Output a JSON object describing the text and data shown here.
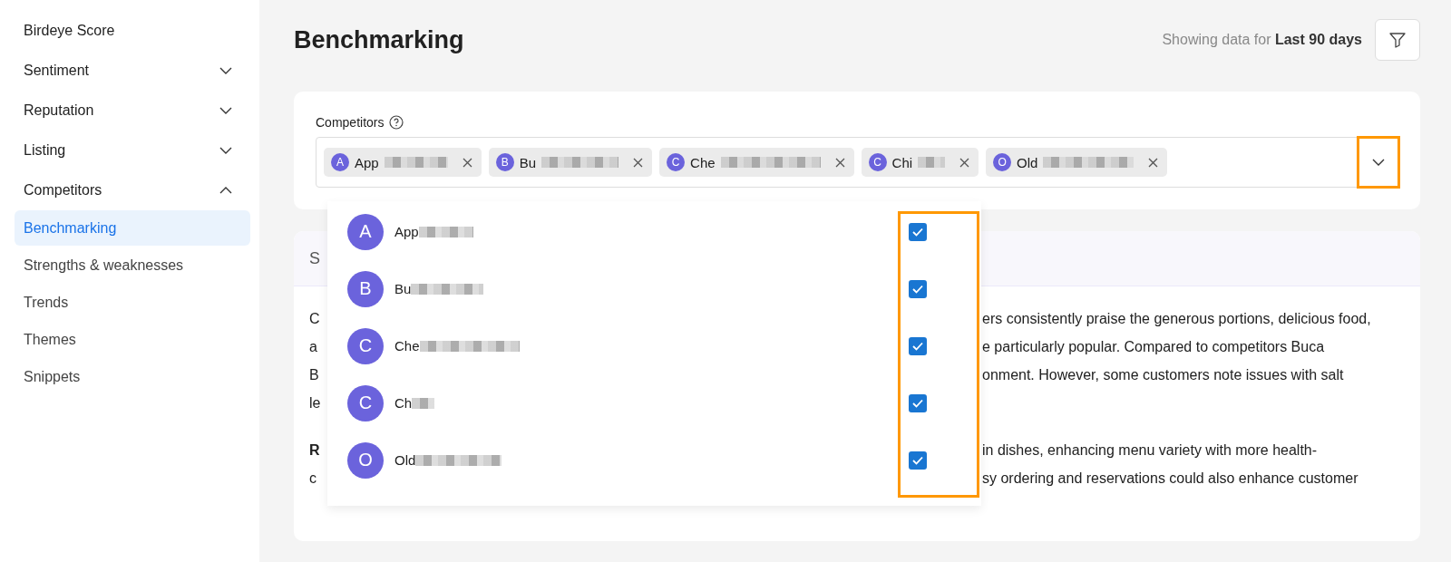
{
  "sidebar": {
    "items": [
      {
        "label": "Birdeye Score",
        "kind": "link",
        "selected": false
      },
      {
        "label": "Sentiment",
        "kind": "group",
        "expanded": false
      },
      {
        "label": "Reputation",
        "kind": "group",
        "expanded": false
      },
      {
        "label": "Listing",
        "kind": "group",
        "expanded": false
      },
      {
        "label": "Competitors",
        "kind": "group",
        "expanded": true,
        "children": [
          {
            "label": "Benchmarking",
            "selected": true
          },
          {
            "label": "Strengths & weaknesses",
            "selected": false
          },
          {
            "label": "Trends",
            "selected": false
          },
          {
            "label": "Themes",
            "selected": false
          },
          {
            "label": "Snippets",
            "selected": false
          }
        ]
      }
    ]
  },
  "page": {
    "title": "Benchmarking",
    "range_prefix": "Showing data for",
    "range": "Last 90 days"
  },
  "competitors": {
    "label": "Competitors",
    "toggle_highlighted": true,
    "chips": [
      {
        "letter": "A",
        "name": "App",
        "redacted": true
      },
      {
        "letter": "B",
        "name": "Bu",
        "redacted": true
      },
      {
        "letter": "C",
        "name": "Che",
        "redacted": true
      },
      {
        "letter": "C",
        "name": "Chi",
        "redacted": true
      },
      {
        "letter": "O",
        "name": "Old",
        "redacted": true
      }
    ]
  },
  "dropdown": {
    "checks_highlighted": true,
    "options": [
      {
        "letter": "A",
        "name": "App",
        "redacted": true,
        "checked": true
      },
      {
        "letter": "B",
        "name": "Bu",
        "redacted": true,
        "checked": true
      },
      {
        "letter": "C",
        "name": "Che",
        "redacted": true,
        "checked": true
      },
      {
        "letter": "C",
        "name": "Ch",
        "redacted": true,
        "checked": true
      },
      {
        "letter": "O",
        "name": "Old",
        "redacted": true,
        "checked": true
      }
    ]
  },
  "summary": {
    "header": "S",
    "paragraphs": [
      {
        "lines": [
          {
            "left": "C",
            "right": "ers consistently praise the generous portions, delicious food,"
          },
          {
            "left": "a",
            "right": "e particularly popular. Compared to competitors Buca"
          },
          {
            "left": "B",
            "right": "onment. However, some customers note issues with salt"
          },
          {
            "left": "le"
          }
        ]
      },
      {
        "lines": [
          {
            "left": "**R**",
            "right": "in dishes, enhancing menu variety with more health-"
          },
          {
            "left": "c",
            "right": "sy ordering and reservations could also enhance customer"
          }
        ]
      }
    ]
  }
}
